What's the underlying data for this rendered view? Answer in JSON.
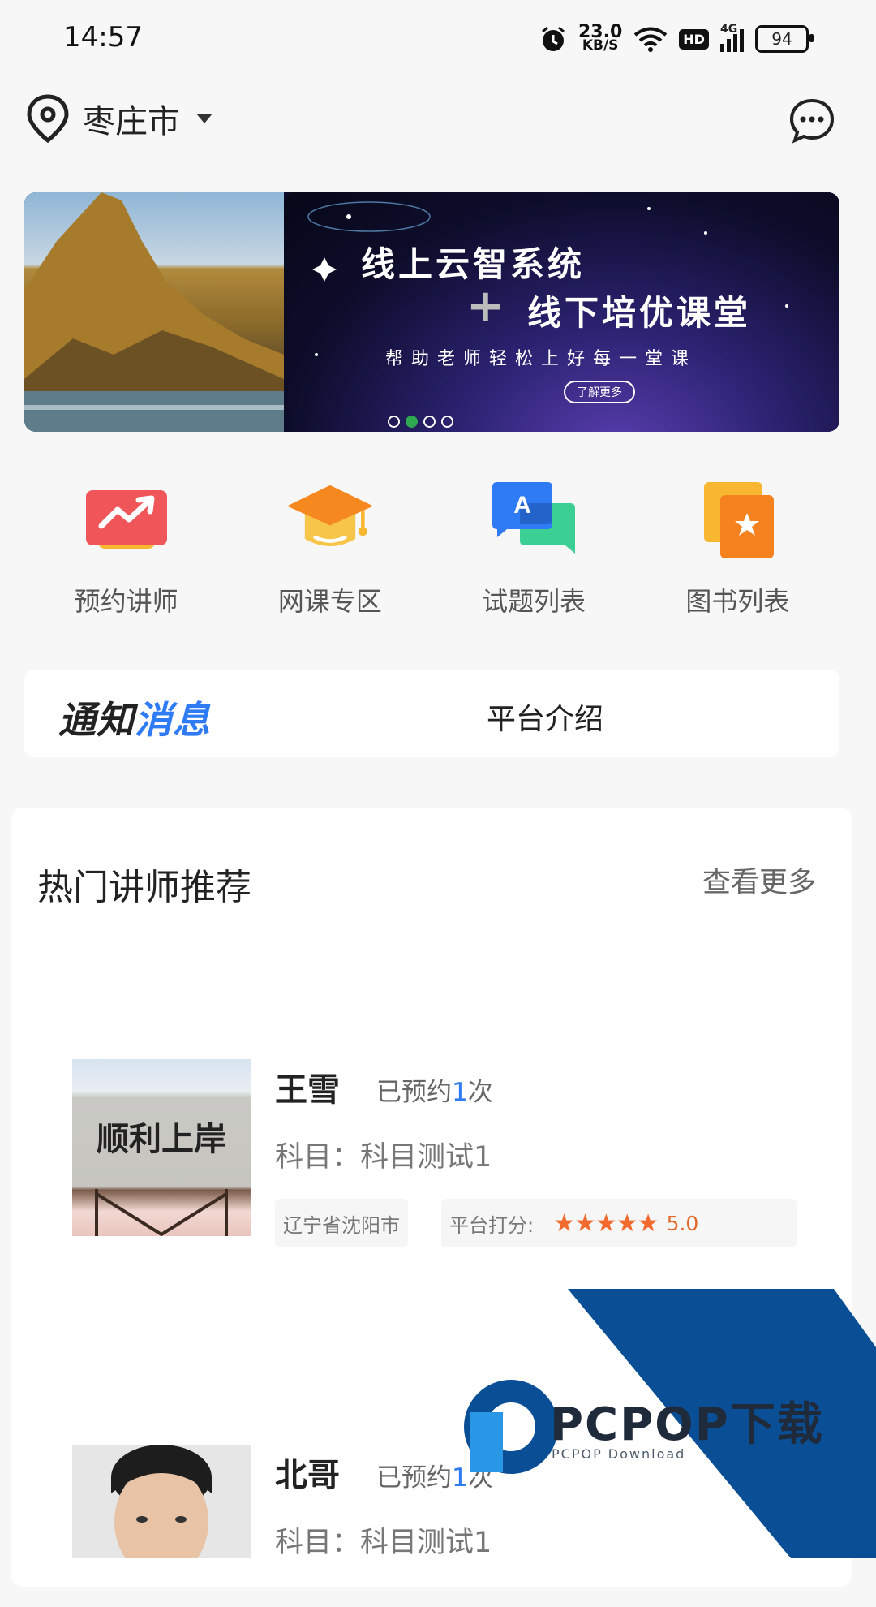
{
  "status_bar": {
    "time": "14:57",
    "speed_value": "23.0",
    "speed_unit": "KB/S",
    "hd": "HD",
    "network": "4G",
    "battery": "94"
  },
  "header": {
    "city": "枣庄市"
  },
  "banner": {
    "line1": "线上云智系统",
    "line2": "线下培优课堂",
    "subtitle": "帮助老师轻松上好每一堂课",
    "button": "了解更多",
    "page_count": 4,
    "active_index": 1
  },
  "menu": [
    {
      "label": "预约讲师",
      "icon": "trend-chart-icon"
    },
    {
      "label": "网课专区",
      "icon": "graduation-cap-icon"
    },
    {
      "label": "试题列表",
      "icon": "chat-translate-icon"
    },
    {
      "label": "图书列表",
      "icon": "book-star-icon"
    }
  ],
  "notice": {
    "tag_part1": "通知",
    "tag_part2": "消息",
    "text": "平台介绍"
  },
  "hot": {
    "title": "热门讲师推荐",
    "more": "查看更多",
    "teachers": [
      {
        "name": "王雪",
        "booked_prefix": "已预约",
        "booked_count": "1",
        "booked_suffix": "次",
        "subject": "科目：科目测试1",
        "location": "辽宁省沈阳市",
        "rating_label": "平台打分:",
        "rating": "5.0",
        "photo_text": "顺利上岸"
      },
      {
        "name": "北哥",
        "booked_prefix": "已预约",
        "booked_count": "1",
        "booked_suffix": "次",
        "subject": "科目：科目测试1"
      }
    ]
  },
  "watermark": {
    "brand": "PCPOP下载",
    "sub": "PCPOP Download"
  },
  "colors": {
    "accent": "#2f7bf5",
    "star": "#f26a2e",
    "watermark_blue": "#0a4f96"
  }
}
